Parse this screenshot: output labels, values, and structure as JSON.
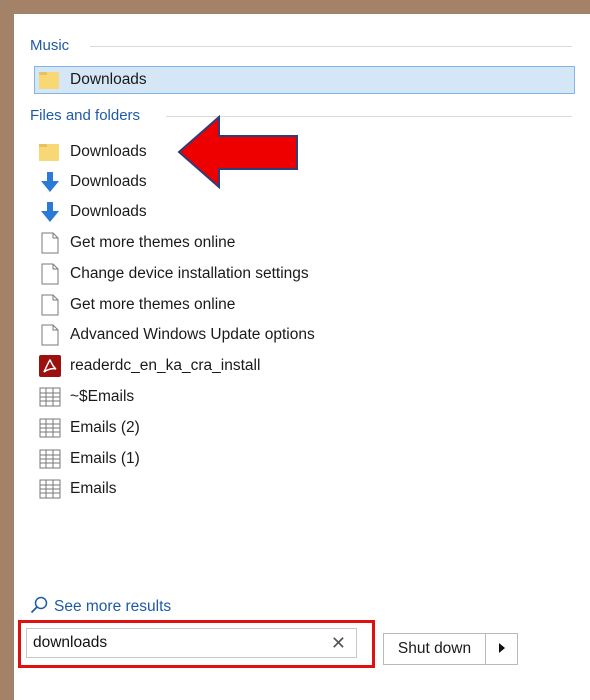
{
  "sections": {
    "music_label": "Music",
    "files_label": "Files and folders"
  },
  "music_results": [
    {
      "label": "Downloads",
      "icon": "folder-icon"
    }
  ],
  "file_results": [
    {
      "label": "Downloads",
      "icon": "folder-icon"
    },
    {
      "label": "Downloads",
      "icon": "download-arrow-icon"
    },
    {
      "label": "Downloads",
      "icon": "download-arrow-icon"
    },
    {
      "label": "Get more themes online",
      "icon": "document-icon"
    },
    {
      "label": "Change device installation settings",
      "icon": "document-icon"
    },
    {
      "label": "Get more themes online",
      "icon": "document-icon"
    },
    {
      "label": "Advanced Windows Update options",
      "icon": "document-icon"
    },
    {
      "label": "readerdc_en_ka_cra_install",
      "icon": "adobe-icon"
    },
    {
      "label": "~$Emails",
      "icon": "spreadsheet-icon"
    },
    {
      "label": "Emails (2)",
      "icon": "spreadsheet-icon"
    },
    {
      "label": "Emails (1)",
      "icon": "spreadsheet-icon"
    },
    {
      "label": "Emails",
      "icon": "spreadsheet-icon"
    }
  ],
  "see_more": "See more results",
  "search": {
    "value": "downloads"
  },
  "shutdown": {
    "label": "Shut down"
  },
  "colors": {
    "accent_blue": "#1e5aa8",
    "highlight_red": "#e01010",
    "selection": "#d5e7f7",
    "background_frame": "#a48268"
  }
}
